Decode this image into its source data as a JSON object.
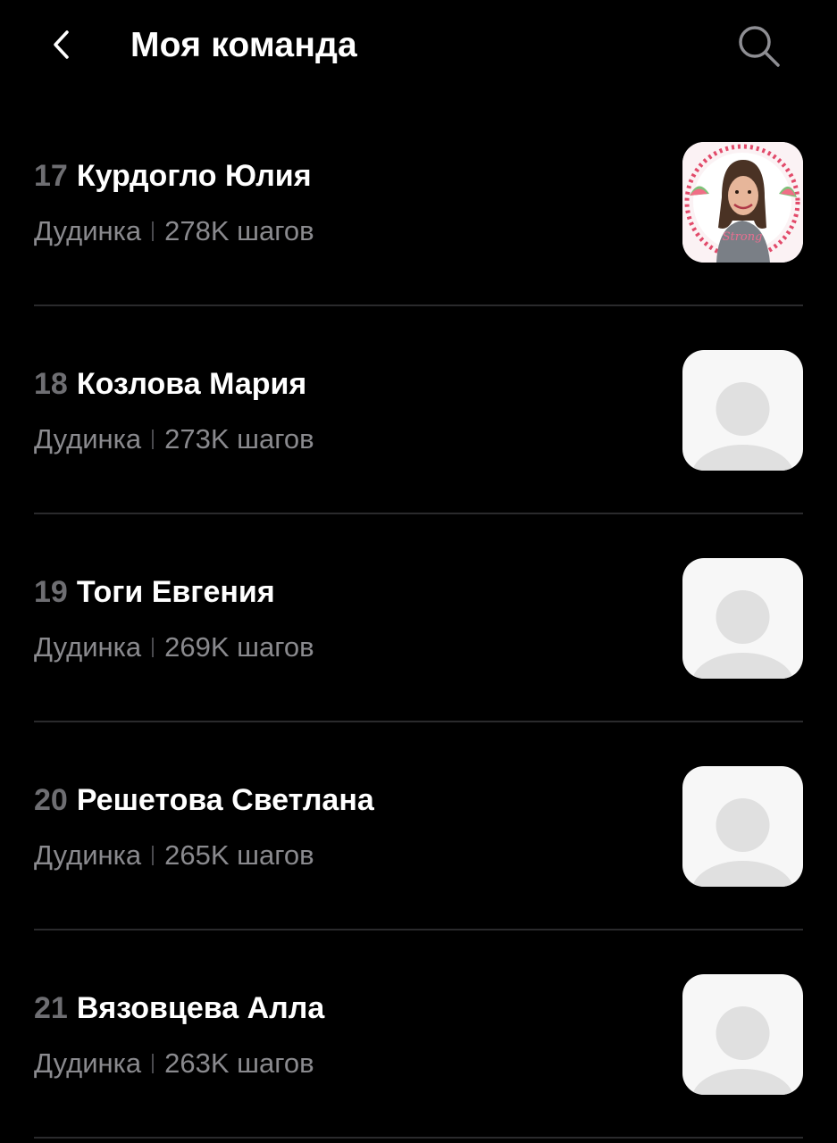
{
  "header": {
    "title": "Моя команда",
    "back_icon": "chevron-left-icon",
    "search_icon": "search-icon"
  },
  "members": [
    {
      "rank": "17",
      "name": "Курдогло Юлия",
      "city": "Дудинка",
      "steps": "278K шагов",
      "avatar": "photo"
    },
    {
      "rank": "18",
      "name": "Козлова Мария",
      "city": "Дудинка",
      "steps": "273K шагов",
      "avatar": "placeholder"
    },
    {
      "rank": "19",
      "name": "Тоги Евгения",
      "city": "Дудинка",
      "steps": "269K шагов",
      "avatar": "placeholder"
    },
    {
      "rank": "20",
      "name": "Решетова Светлана",
      "city": "Дудинка",
      "steps": "265K шагов",
      "avatar": "placeholder"
    },
    {
      "rank": "21",
      "name": "Вязовцева Алла",
      "city": "Дудинка",
      "steps": "263K шагов",
      "avatar": "placeholder"
    }
  ],
  "colors": {
    "background": "#000000",
    "text_primary": "#ffffff",
    "text_secondary": "#8a8a8e",
    "rank": "#6e6e72",
    "divider": "#2a2a2c",
    "avatar_bg": "#f7f7f7",
    "avatar_silhouette": "#e0e0e0"
  }
}
